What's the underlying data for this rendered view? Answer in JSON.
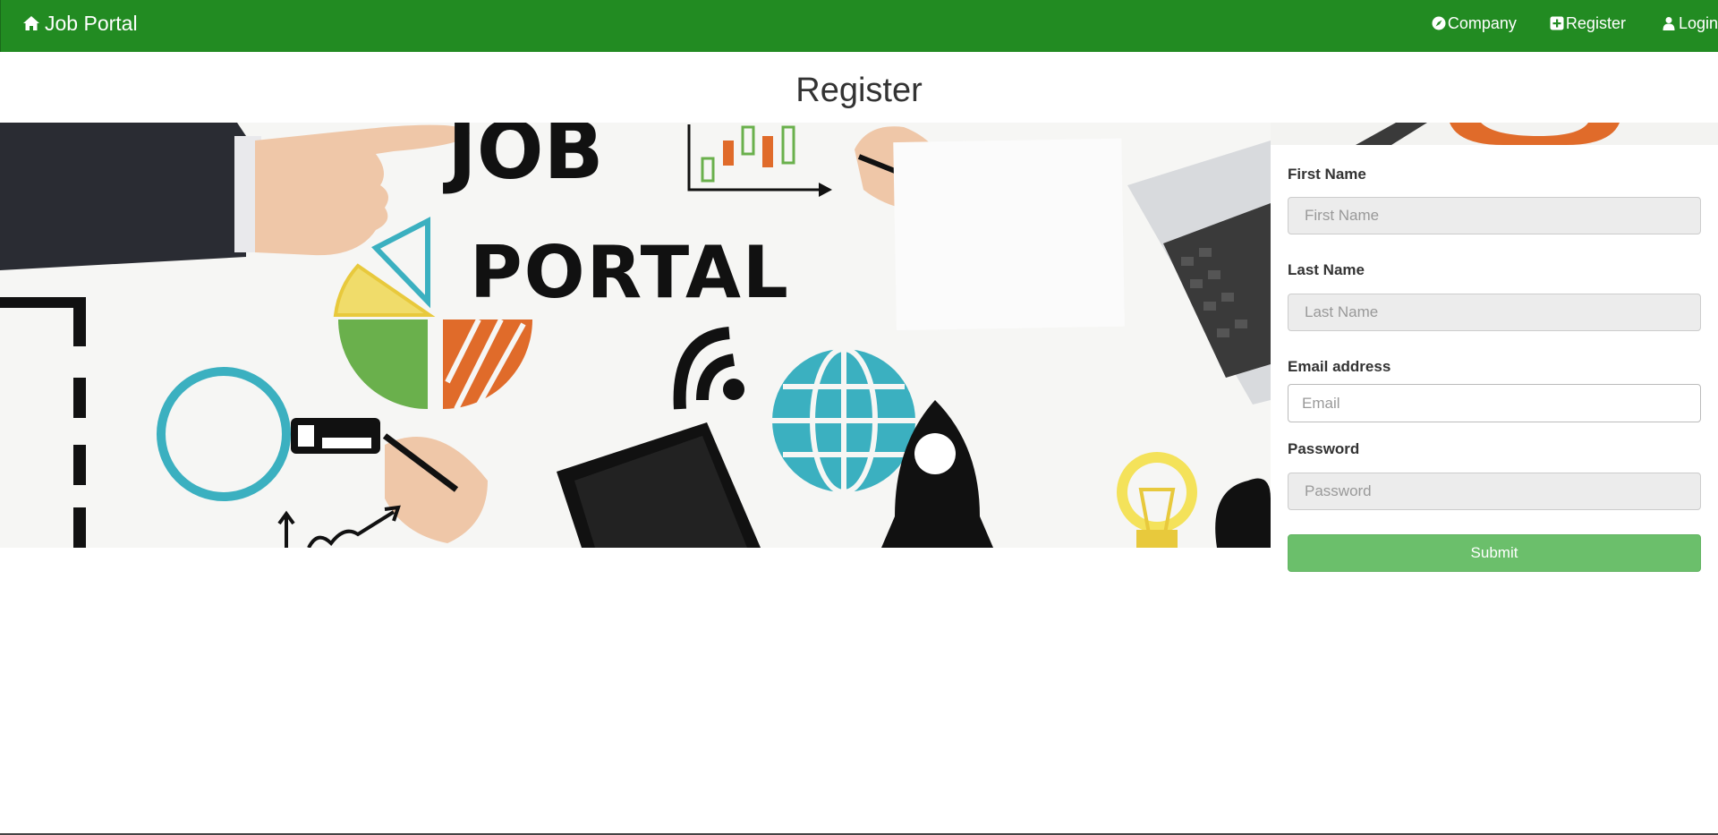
{
  "navbar": {
    "brand": "Job Portal",
    "brand_icon": "home-icon",
    "items": [
      {
        "label": "Company",
        "icon": "compass-icon"
      },
      {
        "label": "Register",
        "icon": "plus-square-icon"
      },
      {
        "label": "Login",
        "icon": "user-icon"
      }
    ],
    "background": "#228b22"
  },
  "page": {
    "title": "Register"
  },
  "banner": {
    "line1": "JOB",
    "line2": "PORTAL"
  },
  "form": {
    "first_name": {
      "label": "First Name",
      "placeholder": "First Name",
      "value": ""
    },
    "last_name": {
      "label": "Last Name",
      "placeholder": "Last Name",
      "value": ""
    },
    "email": {
      "label": "Email address",
      "placeholder": "Email",
      "value": ""
    },
    "password": {
      "label": "Password",
      "placeholder": "Password",
      "value": ""
    },
    "submit_label": "Submit",
    "submit_color": "#6bbf6b"
  }
}
